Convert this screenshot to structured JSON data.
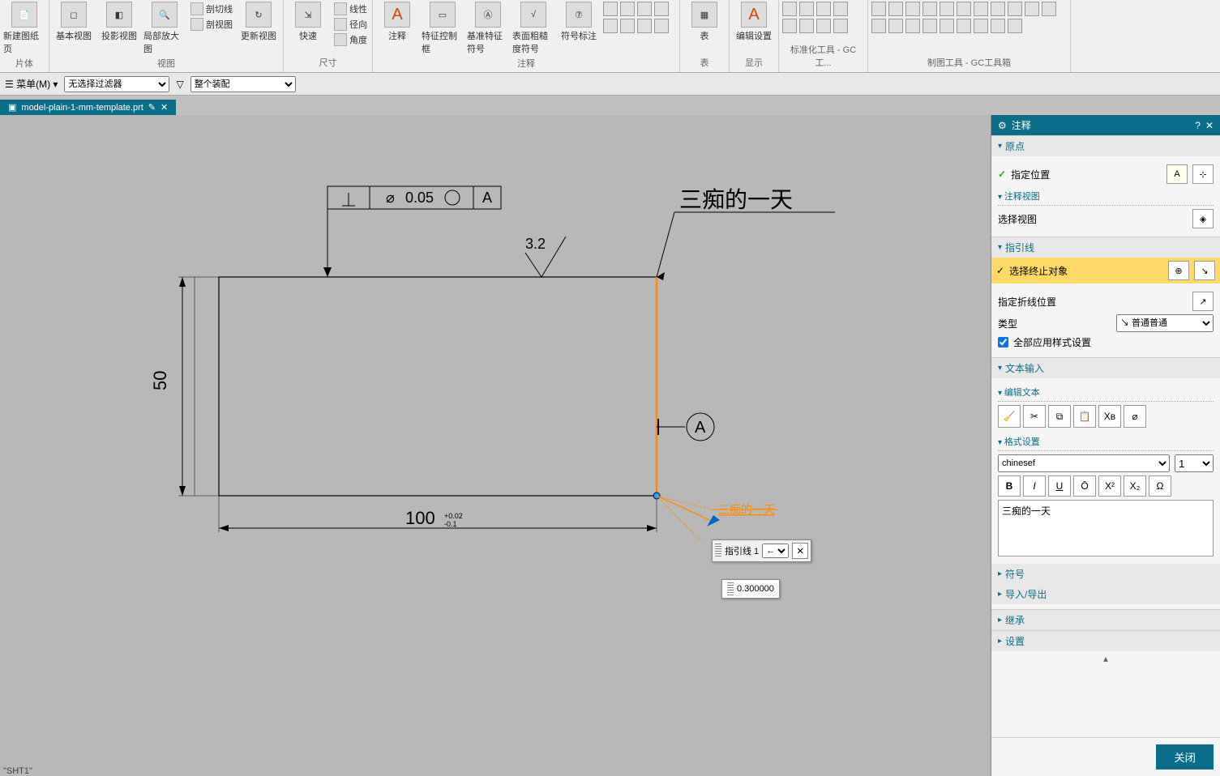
{
  "ribbon": {
    "groups": [
      {
        "label": "片体",
        "items": [
          {
            "t": "新建图纸页"
          }
        ]
      },
      {
        "label": "视图",
        "items": [
          {
            "t": "基本视图"
          },
          {
            "t": "投影视图"
          },
          {
            "t": "局部放大图"
          }
        ],
        "side": [
          {
            "t": "剖切线"
          },
          {
            "t": "剖视图"
          }
        ],
        "extra": [
          {
            "t": "更新视图"
          }
        ]
      },
      {
        "label": "尺寸",
        "items": [
          {
            "t": "快速"
          }
        ],
        "side": [
          {
            "t": "线性"
          },
          {
            "t": "径向"
          },
          {
            "t": "角度"
          }
        ]
      },
      {
        "label": "注释",
        "items": [
          {
            "t": "注释"
          },
          {
            "t": "特征控制框"
          },
          {
            "t": "基准特征符号"
          },
          {
            "t": "表面粗糙度符号"
          },
          {
            "t": "符号标注"
          }
        ]
      },
      {
        "label": "表",
        "items": [
          {
            "t": "表"
          }
        ]
      },
      {
        "label": "显示",
        "items": [
          {
            "t": "编辑设置"
          }
        ]
      },
      {
        "label": "标准化工具 - GC工...",
        "items": []
      },
      {
        "label": "制图工具 - GC工具箱",
        "items": []
      }
    ]
  },
  "toolbar2": {
    "menu": "菜单(M)",
    "filter": "无选择过滤器",
    "assembly": "整个装配"
  },
  "tab": {
    "name": "model-plain-1-mm-template.prt"
  },
  "drawing": {
    "gtol": "0.05",
    "datum": "A",
    "surf": "3.2",
    "dim_h": "50",
    "dim_w": "100",
    "dim_w_tol_up": "+0.02",
    "dim_w_tol_low": "-0.1",
    "note": "三痴的一天",
    "note_preview": "三痴的一天"
  },
  "float": {
    "leader_label": "指引线 1",
    "arrow": "←",
    "value": "0.300000"
  },
  "panel": {
    "title": "注释",
    "sections": {
      "origin": {
        "head": "原点",
        "loc": "指定位置",
        "view_head": "注释视图",
        "view_sel": "选择视图"
      },
      "leader": {
        "head": "指引线",
        "terminate": "选择终止对象",
        "break": "指定折线位置",
        "type_label": "类型",
        "type_value": "普通",
        "apply_all": "全部应用样式设置"
      },
      "text": {
        "head": "文本输入",
        "edit": "编辑文本",
        "format": "格式设置",
        "font": "chinesef",
        "size": "1",
        "content": "三痴的一天"
      },
      "symbol": "符号",
      "importexport": "导入/导出",
      "inherit": "继承",
      "settings": "设置"
    },
    "close": "关闭"
  },
  "status": "\"SHT1\""
}
